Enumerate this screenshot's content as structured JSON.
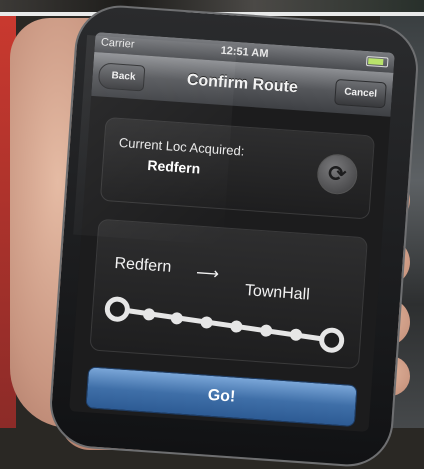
{
  "status_bar": {
    "carrier": "Carrier",
    "time": "12:51 AM"
  },
  "nav": {
    "title": "Confirm Route",
    "back_label": "Back",
    "cancel_label": "Cancel"
  },
  "location": {
    "label": "Current Loc Acquired:",
    "value": "Redfern"
  },
  "route": {
    "from": "Redfern",
    "to": "TownHall",
    "arrow": "⟶"
  },
  "actions": {
    "go_label": "Go!"
  },
  "icons": {
    "refresh": "refresh-icon",
    "battery": "battery-icon"
  },
  "colors": {
    "go_button": "#3f6fa8",
    "battery_fill": "#b9e36b"
  }
}
